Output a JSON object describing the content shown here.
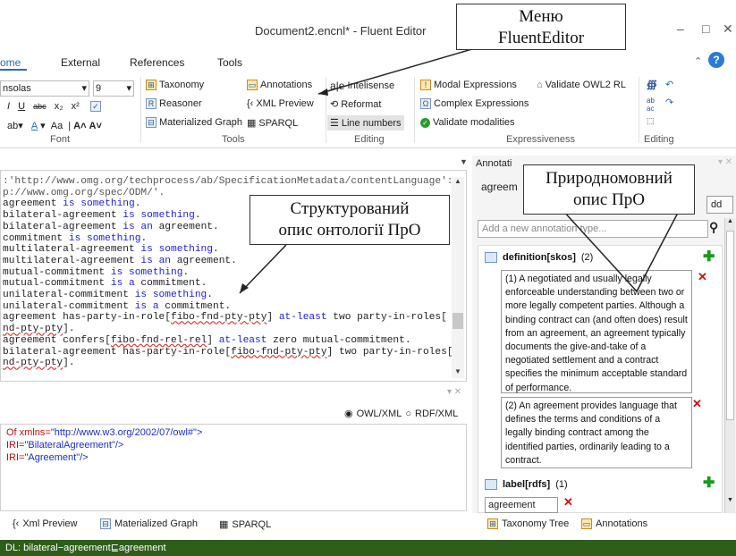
{
  "window": {
    "title": "Document2.encnl* - Fluent Editor",
    "controls": [
      "–",
      "□",
      "✕"
    ]
  },
  "tabs": [
    {
      "label": "ome"
    },
    {
      "label": "External"
    },
    {
      "label": "References"
    },
    {
      "label": "Tools"
    }
  ],
  "font_group": {
    "font_name": "nsolas",
    "font_size": "9",
    "label": "Font"
  },
  "tools_group": {
    "items": [
      "Taxonomy",
      "Reasoner",
      "Materialized Graph",
      "Annotations",
      "XML Preview",
      "SPARQL"
    ],
    "label": "Tools"
  },
  "editing_group": {
    "items": [
      "Intelisense",
      "Reformat",
      "Line numbers"
    ],
    "label": "Editing"
  },
  "expressiveness_group": {
    "items": [
      "Modal Expressions",
      "Complex Expressions",
      "Validate modalities",
      "Validate OWL2 RL"
    ],
    "label": "Expressiveness"
  },
  "editing2_group": {
    "label": "Editing"
  },
  "code_lines": [
    [
      {
        "t": ":'http://www.omg.org/techprocess/ab/SpecificationMetadata/contentLanguage':",
        "c": "str"
      }
    ],
    [
      {
        "t": "p://www.omg.org/spec/ODM/'.",
        "c": "str"
      }
    ],
    [
      {
        "t": "agreement ",
        "c": ""
      },
      {
        "t": "is something",
        "c": "kw"
      },
      {
        "t": ".",
        "c": ""
      }
    ],
    [
      {
        "t": "bilateral-agreement ",
        "c": ""
      },
      {
        "t": "is something",
        "c": "kw"
      },
      {
        "t": ".",
        "c": ""
      }
    ],
    [
      {
        "t": "bilateral-agreement ",
        "c": ""
      },
      {
        "t": "is an",
        "c": "kw"
      },
      {
        "t": " agreement.",
        "c": ""
      }
    ],
    [
      {
        "t": "commitment ",
        "c": ""
      },
      {
        "t": "is something",
        "c": "kw"
      },
      {
        "t": ".",
        "c": ""
      }
    ],
    [
      {
        "t": "multilateral-agreement ",
        "c": ""
      },
      {
        "t": "is something",
        "c": "kw"
      },
      {
        "t": ".",
        "c": ""
      }
    ],
    [
      {
        "t": "multilateral-agreement ",
        "c": ""
      },
      {
        "t": "is an",
        "c": "kw"
      },
      {
        "t": " agreement.",
        "c": ""
      }
    ],
    [
      {
        "t": "mutual-commitment ",
        "c": ""
      },
      {
        "t": "is something",
        "c": "kw"
      },
      {
        "t": ".",
        "c": ""
      }
    ],
    [
      {
        "t": "mutual-commitment ",
        "c": ""
      },
      {
        "t": "is a",
        "c": "kw"
      },
      {
        "t": " commitment.",
        "c": ""
      }
    ],
    [
      {
        "t": "unilateral-commitment ",
        "c": ""
      },
      {
        "t": "is something",
        "c": "kw"
      },
      {
        "t": ".",
        "c": ""
      }
    ],
    [
      {
        "t": "unilateral-commitment ",
        "c": ""
      },
      {
        "t": "is a",
        "c": "kw"
      },
      {
        "t": " commitment.",
        "c": ""
      }
    ],
    [
      {
        "t": "agreement has-party-in-role[",
        "c": ""
      },
      {
        "t": "fibo-fnd-pty-pty",
        "c": "red"
      },
      {
        "t": "] ",
        "c": ""
      },
      {
        "t": "at-least",
        "c": "kw"
      },
      {
        "t": " two party-in-roles[",
        "c": ""
      }
    ],
    [
      {
        "t": "nd-pty-pty",
        "c": "red"
      },
      {
        "t": "].",
        "c": ""
      }
    ],
    [
      {
        "t": "agreement confers[",
        "c": ""
      },
      {
        "t": "fibo-fnd-rel-rel",
        "c": "red"
      },
      {
        "t": "] ",
        "c": ""
      },
      {
        "t": "at-least",
        "c": "kw"
      },
      {
        "t": " zero mutual-commitment.",
        "c": ""
      }
    ],
    [
      {
        "t": "bilateral-agreement has-party-in-role[",
        "c": ""
      },
      {
        "t": "fibo-fnd-pty-pty",
        "c": "red"
      },
      {
        "t": "] two party-in-roles[",
        "c": ""
      }
    ],
    [
      {
        "t": "nd-pty-pty",
        "c": "red"
      },
      {
        "t": "].",
        "c": ""
      }
    ]
  ],
  "xml_format": {
    "owl": "OWL/XML",
    "rdf": "RDF/XML"
  },
  "xml_lines": [
    {
      "a": "Of xmlns=",
      "v": "\"http://www.w3.org/2002/07/owl#\">"
    },
    {
      "a": " IRI=",
      "v": "\"BilateralAgreement\"/>"
    },
    {
      "a": " IRI=",
      "v": "\"Agreement\"/>"
    }
  ],
  "bottom_tabs": [
    "Xml Preview",
    "Materialized Graph",
    "SPARQL"
  ],
  "right_tabs": [
    "Taxonomy Tree",
    "Annotations"
  ],
  "status": "DL: bilateral−agreement⊑agreement",
  "annot": {
    "title": "Annotati",
    "entity": "agreem",
    "add_button": "dd",
    "type_placeholder": "Add a new annotation type...",
    "definition_header": "definition[skos]",
    "definition_count": "(2)",
    "definitions": [
      "(1) A negotiated and usually legally enforceable understanding between two or more legally competent parties. Although a binding contract can (and often does) result from an agreement, an agreement typically documents the give-and-take of a negotiated settlement and a contract specifies the minimum acceptable standard of performance.",
      "(2) An agreement provides language that defines the terms and conditions of a legally binding contract among the identified parties, ordinarily leading to a contract."
    ],
    "label_header": "label[rdfs]",
    "label_count": "(1)",
    "label_value": "agreement"
  },
  "callouts": {
    "menu": "Меню FluentEditor",
    "structured_1": "Структурований",
    "structured_2": "опис онтології ПрО",
    "natural_1": "Природномовний",
    "natural_2": "опис ПрО"
  }
}
